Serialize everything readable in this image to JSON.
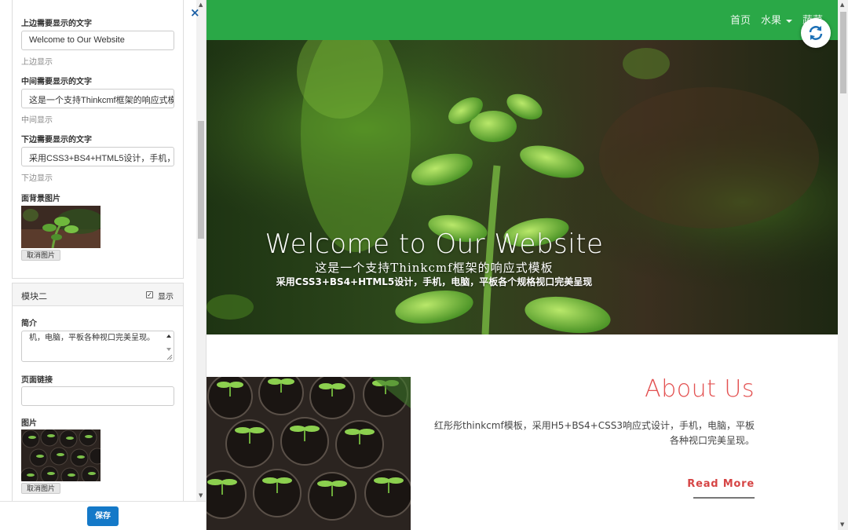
{
  "editor": {
    "close_glyph": "×",
    "save_label": "保存",
    "module1": {
      "top_label": "上边需要显示的文字",
      "top_value": "Welcome to Our Website",
      "top_help": "上边显示",
      "middle_label": "中间需要显示的文字",
      "middle_value": "这是一个支持Thinkcmf框架的响应式模",
      "middle_help": "中间显示",
      "bottom_label": "下边需要显示的文字",
      "bottom_value": "采用CSS3+BS4+HTML5设计，手机，",
      "bottom_help": "下边显示",
      "bg_label": "面背景图片",
      "cancel_label": "取消图片"
    },
    "module2": {
      "title": "模块二",
      "show_label": "显示",
      "show_checked": true,
      "intro_label": "简介",
      "intro_value": "机，电脑，平板各种视口完美呈现。",
      "link_label": "页面链接",
      "link_value": "",
      "image_label": "图片",
      "cancel_label": "取消图片"
    }
  },
  "site": {
    "nav": [
      "首页",
      "水果",
      "蔬菜"
    ],
    "hero": {
      "title": "Welcome to Our Website",
      "subtitle": "这是一个支持Thinkcmf框架的响应式模板",
      "subtitle2": "采用CSS3+BS4+HTML5设计，手机，电脑，平板各个规格视口完美呈现"
    },
    "about": {
      "title": "About Us",
      "text": "红彤彤thinkcmf模板，采用H5+BS4+CSS3响应式设计，手机，电脑，平板各种视口完美呈现。",
      "read_more": "Read More"
    }
  },
  "colors": {
    "navbar": "#2aa847",
    "accent_red": "#e35252",
    "save_button": "#1479c8"
  }
}
